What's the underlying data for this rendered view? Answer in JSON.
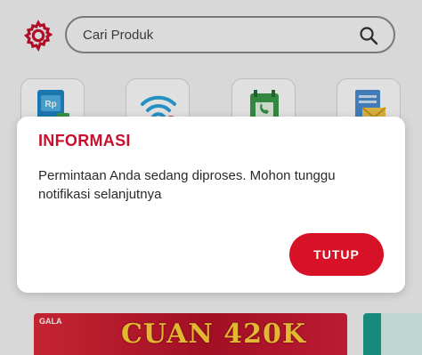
{
  "header": {
    "search_placeholder": "Cari Produk"
  },
  "menu_tiles": [
    {
      "icon": "rupiah-wallet-icon",
      "label": "Rp"
    },
    {
      "icon": "wifi-icon"
    },
    {
      "icon": "phone-book-icon"
    },
    {
      "icon": "bill-document-icon"
    }
  ],
  "promo": {
    "logo_text": "GALA",
    "title": "CUAN 420K"
  },
  "dialog": {
    "title": "INFORMASI",
    "message": "Permintaan Anda sedang diproses. Mohon tunggu notifikasi selanjutnya",
    "button_label": "TUTUP"
  },
  "colors": {
    "brand_red": "#d71226",
    "title_red": "#c8102e"
  }
}
